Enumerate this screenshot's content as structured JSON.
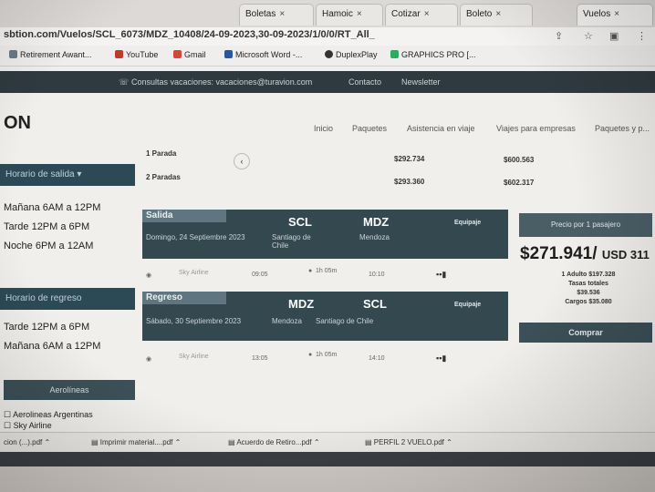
{
  "browser": {
    "tabs": [
      {
        "label": "Boletas"
      },
      {
        "label": "Hamoic"
      },
      {
        "label": "Cotizar"
      },
      {
        "label": "Boleto"
      },
      {
        "label": "Vuelos"
      }
    ],
    "url": "sbtion.com/Vuelos/SCL_6073/MDZ_10408/24-09-2023,30-09-2023/1/0/0/RT_All_",
    "bookmarks": [
      {
        "label": "Retirement Awant...",
        "icon": "bookmark-icon",
        "color": "#6b7a86"
      },
      {
        "label": "YouTube",
        "icon": "youtube-icon",
        "color": "#c0392b"
      },
      {
        "label": "Gmail",
        "icon": "gmail-icon",
        "color": "#d44638"
      },
      {
        "label": "Microsoft Word -...",
        "icon": "word-icon",
        "color": "#2b579a"
      },
      {
        "label": "DuplexPlay",
        "icon": "duplexplay-icon",
        "color": "#333333"
      },
      {
        "label": "GRAPHICS PRO [...",
        "icon": "graphics-icon",
        "color": "#27ae60"
      }
    ]
  },
  "site": {
    "topbar": {
      "contact_email": "Consultas vacaciones: vacaciones@turavion.com",
      "links": [
        "Contacto",
        "Newsletter"
      ]
    },
    "brand": "ON",
    "menu": [
      "Inicio",
      "Paquetes",
      "Asistencia en viaje",
      "Viajes para empresas",
      "Paquetes y p..."
    ]
  },
  "filters": {
    "departure_header": "Horario de salida",
    "departure_options": [
      "Mañana 6AM a 12PM",
      "Tarde 12PM a 6PM",
      "Noche 6PM a 12AM"
    ],
    "return_header": "Horario de regreso",
    "return_options": [
      "Tarde 12PM a 6PM",
      "Mañana 6AM a 12PM"
    ],
    "airlines_button": "Aerolíneas",
    "airlines": [
      "Aerolineas Argentinas",
      "Sky Airline"
    ]
  },
  "stops": [
    {
      "label": "1 Parada",
      "price1": "$292.734",
      "price2": "$600.563"
    },
    {
      "label": "2 Paradas",
      "price1": "$293.360",
      "price2": "$602.317"
    }
  ],
  "outbound": {
    "label": "Salida",
    "from_code": "SCL",
    "to_code": "MDZ",
    "date": "Domingo, 24 Septiembre 2023",
    "from_city": "Santiago de Chile",
    "to_city": "Mendoza",
    "baggage": "Equipaje",
    "option_airline": "Sky Airline",
    "option_time1": "09:05",
    "option_duration": "1h 05m",
    "option_time2": "10:10"
  },
  "inbound": {
    "label": "Regreso",
    "from_code": "MDZ",
    "to_code": "SCL",
    "date": "Sábado, 30 Septiembre 2023",
    "from_city": "Mendoza",
    "to_city": "Santiago de Chile",
    "baggage": "Equipaje",
    "option_airline": "Sky Airline",
    "option_time1": "13:05",
    "option_duration": "1h 05m",
    "option_time2": "14:10"
  },
  "price": {
    "box_label": "Precio por 1 pasajero",
    "total": "$271.941/",
    "currency": "USD 311",
    "details": [
      "1 Adulto $197.328",
      "Tasas totales",
      "$39.536",
      "Cargos $35.080"
    ],
    "buy_label": "Comprar"
  },
  "downloads": [
    {
      "label": "cion (...).pdf"
    },
    {
      "label": "Imprimir material....pdf"
    },
    {
      "label": "Acuerdo de Retiro...pdf"
    },
    {
      "label": "PERFIL 2 VUELO.pdf"
    }
  ]
}
